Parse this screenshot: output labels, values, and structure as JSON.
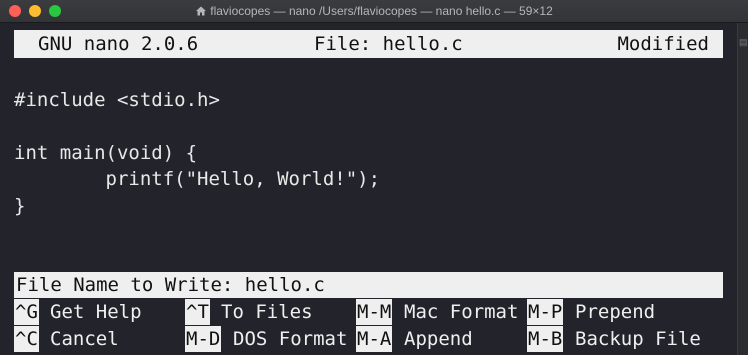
{
  "window": {
    "title": "flaviocopes — nano  /Users/flaviocopes — nano hello.c — 59×12"
  },
  "nano": {
    "version": "GNU nano 2.0.6",
    "file": "File: hello.c",
    "status": "Modified"
  },
  "editor": {
    "lines": [
      "",
      "#include <stdio.h>",
      "",
      "int main(void) {",
      "        printf(\"Hello, World!\");",
      "}",
      "",
      ""
    ]
  },
  "prompt": {
    "label": "File Name to Write:",
    "value": "hello.c"
  },
  "shortcuts": [
    [
      {
        "key": "^G",
        "label": "Get Help"
      },
      {
        "key": "^T",
        "label": "To Files"
      },
      {
        "key": "M-M",
        "label": "Mac Format"
      },
      {
        "key": "M-P",
        "label": "Prepend"
      }
    ],
    [
      {
        "key": "^C",
        "label": "Cancel"
      },
      {
        "key": "M-D",
        "label": "DOS Format"
      },
      {
        "key": "M-A",
        "label": "Append"
      },
      {
        "key": "M-B",
        "label": "Backup File"
      }
    ]
  ]
}
